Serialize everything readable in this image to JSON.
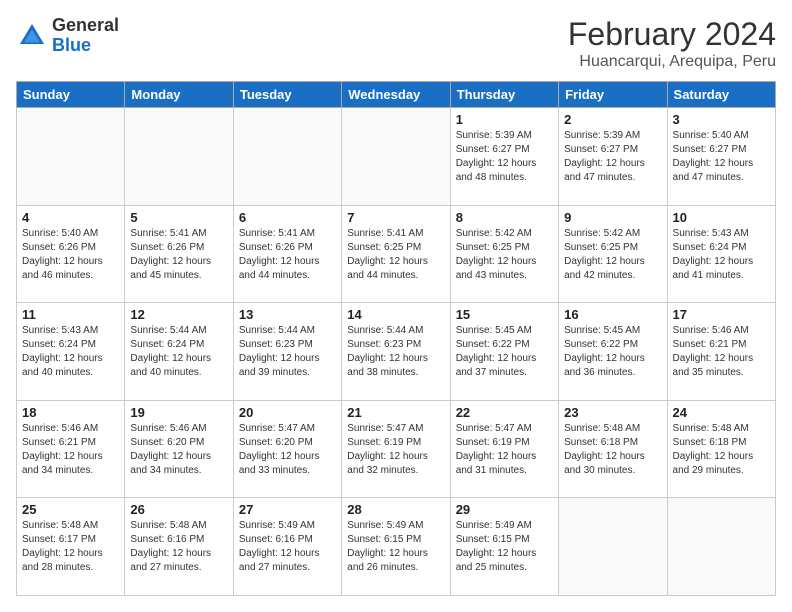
{
  "logo": {
    "general": "General",
    "blue": "Blue"
  },
  "header": {
    "month": "February 2024",
    "location": "Huancarqui, Arequipa, Peru"
  },
  "weekdays": [
    "Sunday",
    "Monday",
    "Tuesday",
    "Wednesday",
    "Thursday",
    "Friday",
    "Saturday"
  ],
  "weeks": [
    [
      {
        "day": "",
        "info": ""
      },
      {
        "day": "",
        "info": ""
      },
      {
        "day": "",
        "info": ""
      },
      {
        "day": "",
        "info": ""
      },
      {
        "day": "1",
        "info": "Sunrise: 5:39 AM\nSunset: 6:27 PM\nDaylight: 12 hours\nand 48 minutes."
      },
      {
        "day": "2",
        "info": "Sunrise: 5:39 AM\nSunset: 6:27 PM\nDaylight: 12 hours\nand 47 minutes."
      },
      {
        "day": "3",
        "info": "Sunrise: 5:40 AM\nSunset: 6:27 PM\nDaylight: 12 hours\nand 47 minutes."
      }
    ],
    [
      {
        "day": "4",
        "info": "Sunrise: 5:40 AM\nSunset: 6:26 PM\nDaylight: 12 hours\nand 46 minutes."
      },
      {
        "day": "5",
        "info": "Sunrise: 5:41 AM\nSunset: 6:26 PM\nDaylight: 12 hours\nand 45 minutes."
      },
      {
        "day": "6",
        "info": "Sunrise: 5:41 AM\nSunset: 6:26 PM\nDaylight: 12 hours\nand 44 minutes."
      },
      {
        "day": "7",
        "info": "Sunrise: 5:41 AM\nSunset: 6:25 PM\nDaylight: 12 hours\nand 44 minutes."
      },
      {
        "day": "8",
        "info": "Sunrise: 5:42 AM\nSunset: 6:25 PM\nDaylight: 12 hours\nand 43 minutes."
      },
      {
        "day": "9",
        "info": "Sunrise: 5:42 AM\nSunset: 6:25 PM\nDaylight: 12 hours\nand 42 minutes."
      },
      {
        "day": "10",
        "info": "Sunrise: 5:43 AM\nSunset: 6:24 PM\nDaylight: 12 hours\nand 41 minutes."
      }
    ],
    [
      {
        "day": "11",
        "info": "Sunrise: 5:43 AM\nSunset: 6:24 PM\nDaylight: 12 hours\nand 40 minutes."
      },
      {
        "day": "12",
        "info": "Sunrise: 5:44 AM\nSunset: 6:24 PM\nDaylight: 12 hours\nand 40 minutes."
      },
      {
        "day": "13",
        "info": "Sunrise: 5:44 AM\nSunset: 6:23 PM\nDaylight: 12 hours\nand 39 minutes."
      },
      {
        "day": "14",
        "info": "Sunrise: 5:44 AM\nSunset: 6:23 PM\nDaylight: 12 hours\nand 38 minutes."
      },
      {
        "day": "15",
        "info": "Sunrise: 5:45 AM\nSunset: 6:22 PM\nDaylight: 12 hours\nand 37 minutes."
      },
      {
        "day": "16",
        "info": "Sunrise: 5:45 AM\nSunset: 6:22 PM\nDaylight: 12 hours\nand 36 minutes."
      },
      {
        "day": "17",
        "info": "Sunrise: 5:46 AM\nSunset: 6:21 PM\nDaylight: 12 hours\nand 35 minutes."
      }
    ],
    [
      {
        "day": "18",
        "info": "Sunrise: 5:46 AM\nSunset: 6:21 PM\nDaylight: 12 hours\nand 34 minutes."
      },
      {
        "day": "19",
        "info": "Sunrise: 5:46 AM\nSunset: 6:20 PM\nDaylight: 12 hours\nand 34 minutes."
      },
      {
        "day": "20",
        "info": "Sunrise: 5:47 AM\nSunset: 6:20 PM\nDaylight: 12 hours\nand 33 minutes."
      },
      {
        "day": "21",
        "info": "Sunrise: 5:47 AM\nSunset: 6:19 PM\nDaylight: 12 hours\nand 32 minutes."
      },
      {
        "day": "22",
        "info": "Sunrise: 5:47 AM\nSunset: 6:19 PM\nDaylight: 12 hours\nand 31 minutes."
      },
      {
        "day": "23",
        "info": "Sunrise: 5:48 AM\nSunset: 6:18 PM\nDaylight: 12 hours\nand 30 minutes."
      },
      {
        "day": "24",
        "info": "Sunrise: 5:48 AM\nSunset: 6:18 PM\nDaylight: 12 hours\nand 29 minutes."
      }
    ],
    [
      {
        "day": "25",
        "info": "Sunrise: 5:48 AM\nSunset: 6:17 PM\nDaylight: 12 hours\nand 28 minutes."
      },
      {
        "day": "26",
        "info": "Sunrise: 5:48 AM\nSunset: 6:16 PM\nDaylight: 12 hours\nand 27 minutes."
      },
      {
        "day": "27",
        "info": "Sunrise: 5:49 AM\nSunset: 6:16 PM\nDaylight: 12 hours\nand 27 minutes."
      },
      {
        "day": "28",
        "info": "Sunrise: 5:49 AM\nSunset: 6:15 PM\nDaylight: 12 hours\nand 26 minutes."
      },
      {
        "day": "29",
        "info": "Sunrise: 5:49 AM\nSunset: 6:15 PM\nDaylight: 12 hours\nand 25 minutes."
      },
      {
        "day": "",
        "info": ""
      },
      {
        "day": "",
        "info": ""
      }
    ]
  ]
}
